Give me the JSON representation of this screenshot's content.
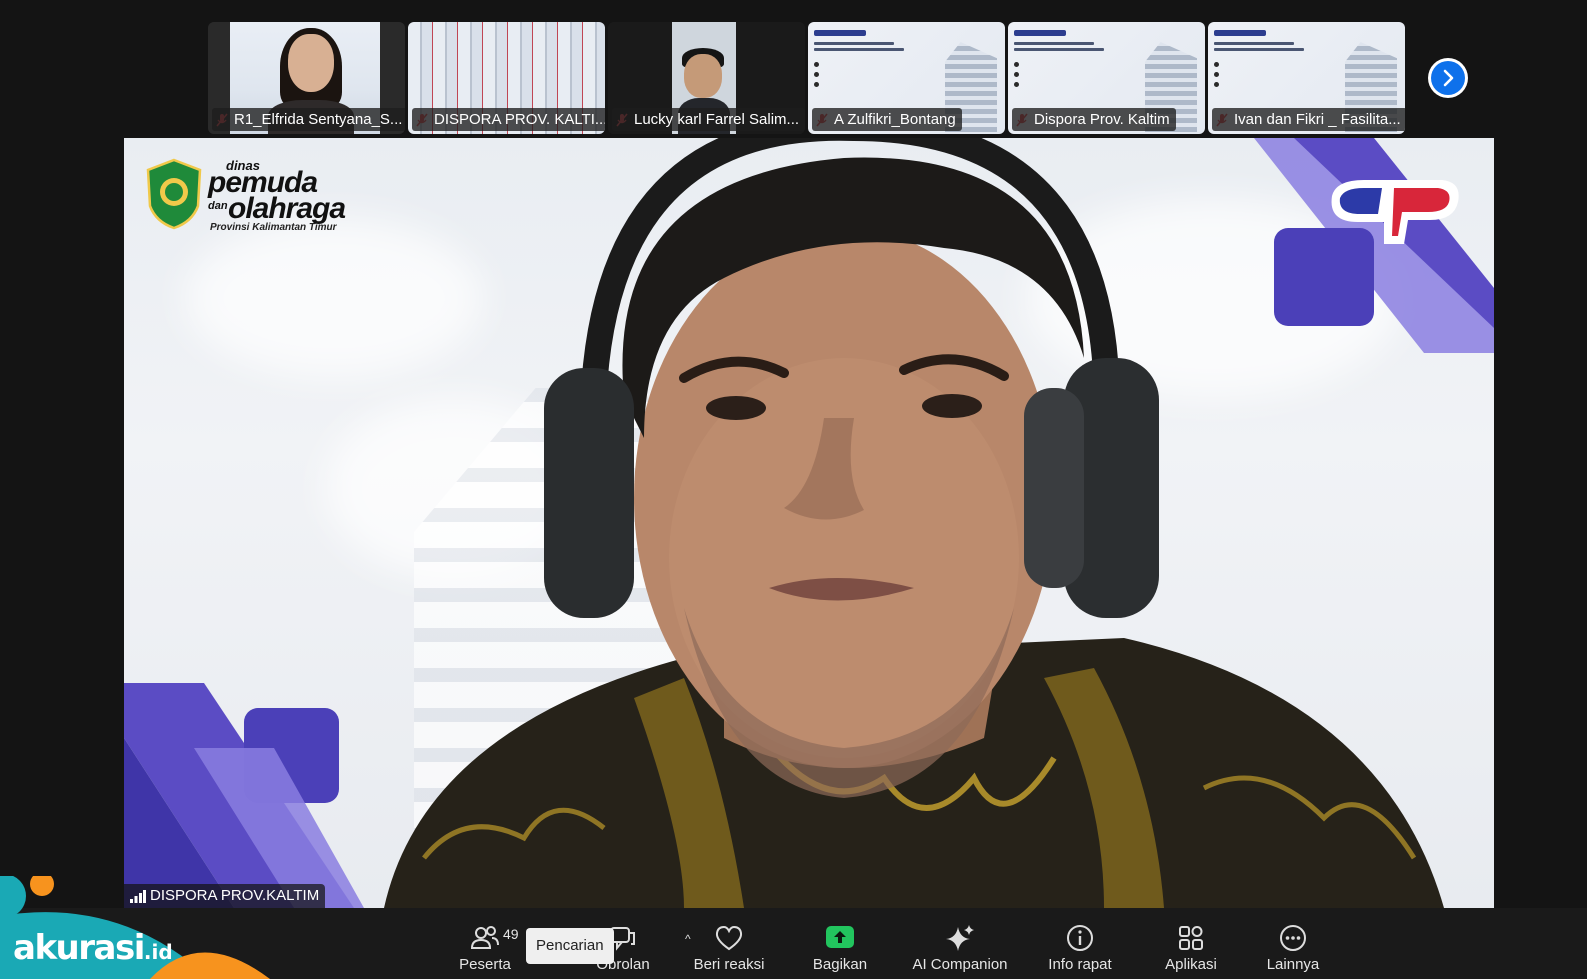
{
  "participants": [
    {
      "name": "R1_Elfrida Sentyana_S...",
      "video": "person1"
    },
    {
      "name": "DISPORA PROV. KALTI...",
      "video": "bars"
    },
    {
      "name": "Lucky karl Farrel Salim...",
      "video": "person3"
    },
    {
      "name": "A Zulfikri_Bontang",
      "video": "slide"
    },
    {
      "name": "Dispora Prov. Kaltim",
      "video": "slide"
    },
    {
      "name": "Ivan dan Fikri _ Fasilita...",
      "video": "slide"
    }
  ],
  "stage": {
    "speaker_name": "DISPORA PROV.KALTIM",
    "logo_left": {
      "line1": "dinas",
      "line2": "pemuda",
      "line3": "dan",
      "line4": "olahraga",
      "line5": "Provinsi Kalimantan Timur"
    },
    "logo_right": "dp"
  },
  "toolbar": {
    "items": [
      {
        "label": "Peserta",
        "icon": "participants-icon",
        "count": "49"
      },
      {
        "label": "Obrolan",
        "icon": "chat-icon"
      },
      {
        "label": "Beri reaksi",
        "icon": "heart-icon"
      },
      {
        "label": "Bagikan",
        "icon": "share-screen-icon"
      },
      {
        "label": "AI Companion",
        "icon": "sparkle-icon"
      },
      {
        "label": "Info rapat",
        "icon": "info-icon"
      },
      {
        "label": "Aplikasi",
        "icon": "apps-icon"
      },
      {
        "label": "Lainnya",
        "icon": "more-icon"
      }
    ],
    "tooltip": "Pencarian"
  },
  "watermark": {
    "brand": "akurasi",
    "tld": ".id"
  },
  "colors": {
    "accent": "#0e71eb",
    "share_green": "#22c55e",
    "mute_red": "#e5484d",
    "stage_purple": "#6a5ad0"
  }
}
